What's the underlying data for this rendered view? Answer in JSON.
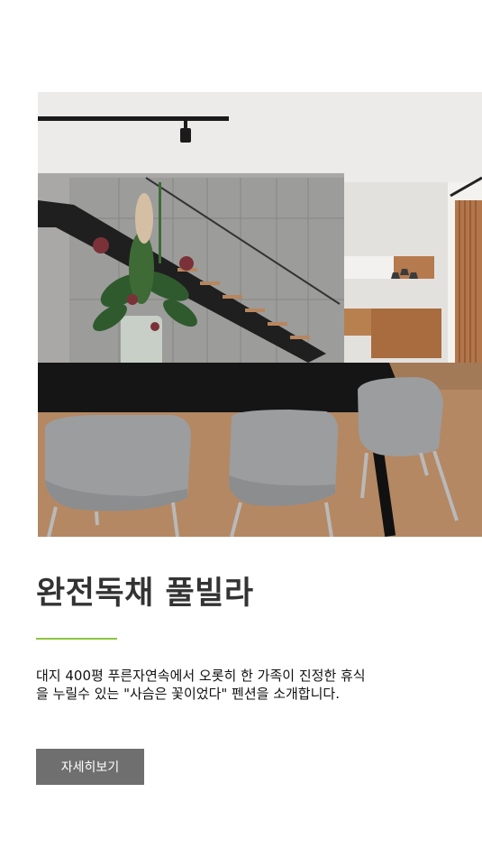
{
  "feature": {
    "photo_alt": "완전독채 풀빌라",
    "title": "완전독채 풀빌라",
    "description": "대지 400평 푸른자연속에서 오롯히 한 가족이 진정한 휴식을 누릴수 있는 \"사슴은 꽃이었다\" 펜션을 소개합니다.",
    "button_label": "자세히보기"
  },
  "colors": {
    "accent_line": "#8cc63f",
    "button_bg": "#6f6f6f",
    "title_text": "#333333"
  }
}
